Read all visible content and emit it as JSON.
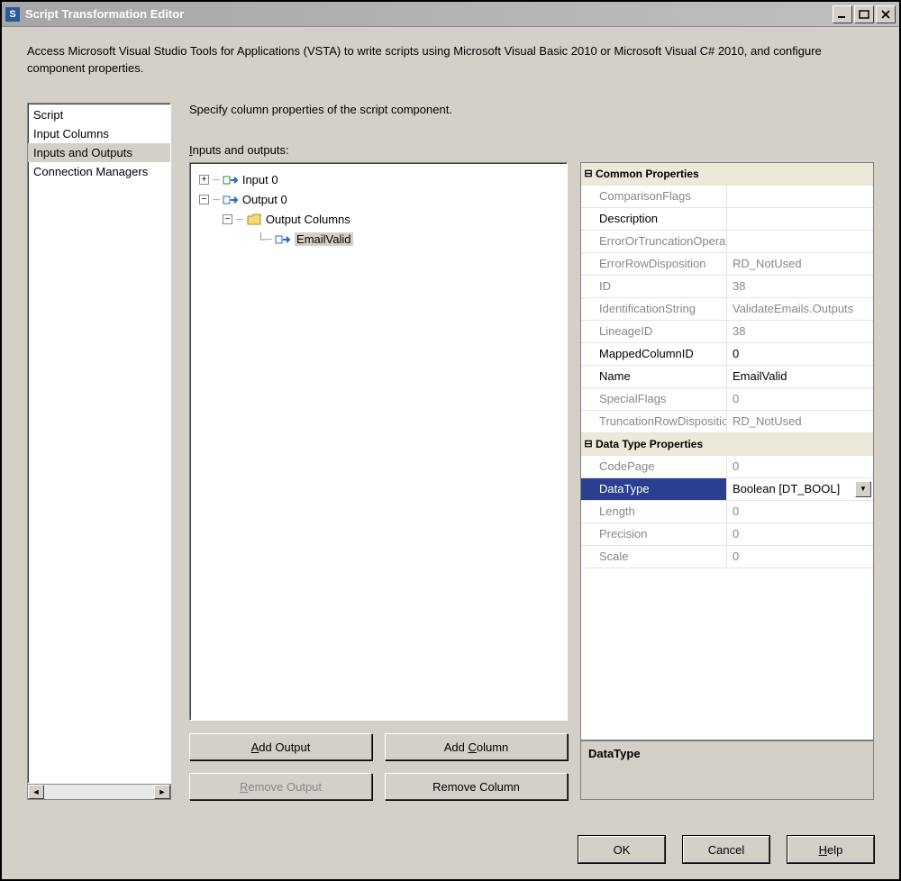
{
  "window": {
    "title": "Script Transformation Editor"
  },
  "desc": "Access Microsoft Visual Studio Tools for Applications (VSTA) to write scripts using Microsoft Visual Basic 2010 or Microsoft Visual C# 2010, and configure component properties.",
  "nav": {
    "items": [
      {
        "label": "Script"
      },
      {
        "label": "Input Columns"
      },
      {
        "label": "Inputs and Outputs"
      },
      {
        "label": "Connection Managers"
      }
    ]
  },
  "section_label": "Specify column properties of the script component.",
  "io_label_prefix": "I",
  "io_label_rest": "nputs and outputs:",
  "tree": {
    "input0": "Input 0",
    "output0": "Output 0",
    "output_columns": "Output Columns",
    "emailvalid": "EmailValid"
  },
  "buttons": {
    "add_output": "Add Output",
    "add_column": "Add Column",
    "remove_output": "Remove Output",
    "remove_column": "Remove Column"
  },
  "propgrid": {
    "cat_common": "Common Properties",
    "cat_datatype": "Data Type Properties",
    "rows": {
      "ComparisonFlags": {
        "label": "ComparisonFlags",
        "value": ""
      },
      "Description": {
        "label": "Description",
        "value": ""
      },
      "ErrorOrTruncation": {
        "label": "ErrorOrTruncationOperation",
        "value": ""
      },
      "ErrorRowDisposition": {
        "label": "ErrorRowDisposition",
        "value": "RD_NotUsed"
      },
      "ID": {
        "label": "ID",
        "value": "38"
      },
      "IdentificationString": {
        "label": "IdentificationString",
        "value": "ValidateEmails.Outputs"
      },
      "LineageID": {
        "label": "LineageID",
        "value": "38"
      },
      "MappedColumnID": {
        "label": "MappedColumnID",
        "value": "0"
      },
      "Name": {
        "label": "Name",
        "value": "EmailValid"
      },
      "SpecialFlags": {
        "label": "SpecialFlags",
        "value": "0"
      },
      "TruncationRowDisposition": {
        "label": "TruncationRowDisposition",
        "value": "RD_NotUsed"
      },
      "CodePage": {
        "label": "CodePage",
        "value": "0"
      },
      "DataType": {
        "label": "DataType",
        "value": "Boolean [DT_BOOL]"
      },
      "Length": {
        "label": "Length",
        "value": "0"
      },
      "Precision": {
        "label": "Precision",
        "value": "0"
      },
      "Scale": {
        "label": "Scale",
        "value": "0"
      }
    }
  },
  "propdesc": "DataType",
  "footer": {
    "ok": "OK",
    "cancel": "Cancel",
    "help": "Help"
  }
}
